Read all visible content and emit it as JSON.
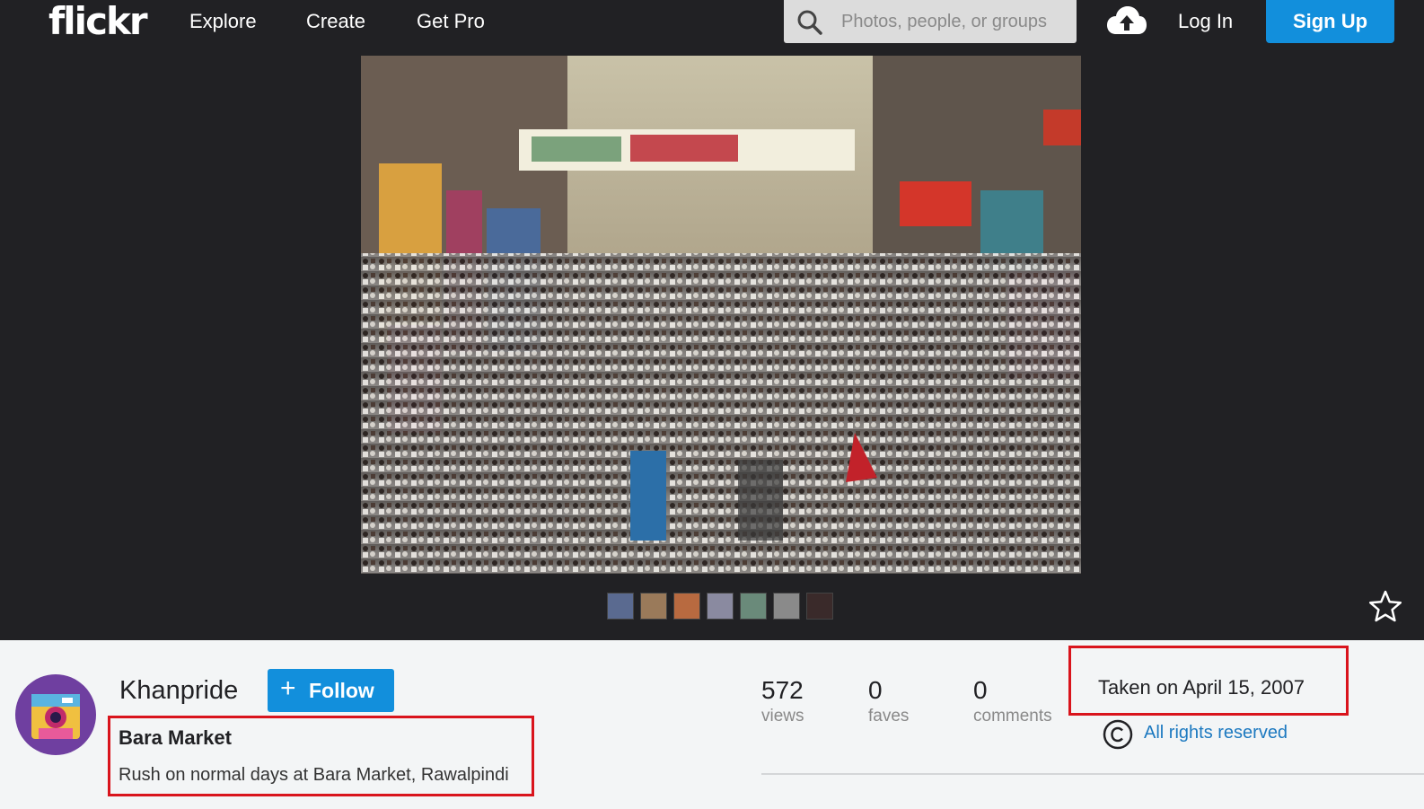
{
  "brand": {
    "logo_text": "flickr"
  },
  "nav": {
    "links": [
      "Explore",
      "Create",
      "Get Pro"
    ],
    "search_placeholder": "Photos, people, or groups",
    "login_label": "Log In",
    "signup_label": "Sign Up",
    "icons": {
      "search": "search-icon",
      "upload": "cloud-upload-icon"
    }
  },
  "photo": {
    "filmstrip_count": 7,
    "fave_icon": "star-icon"
  },
  "owner": {
    "name": "Khanpride",
    "follow_label": "Follow"
  },
  "meta": {
    "title": "Bara Market",
    "description": "Rush on normal days at Bara Market, Rawalpindi"
  },
  "stats": [
    {
      "value": "572",
      "label": "views"
    },
    {
      "value": "0",
      "label": "faves"
    },
    {
      "value": "0",
      "label": "comments"
    }
  ],
  "taken": "Taken on April 15, 2007",
  "license": {
    "label": "All rights reserved",
    "icon": "copyright-icon"
  },
  "colors": {
    "accent": "#128fdc",
    "highlight": "#d9141c",
    "header": "#212124",
    "link": "#1c79c0"
  }
}
